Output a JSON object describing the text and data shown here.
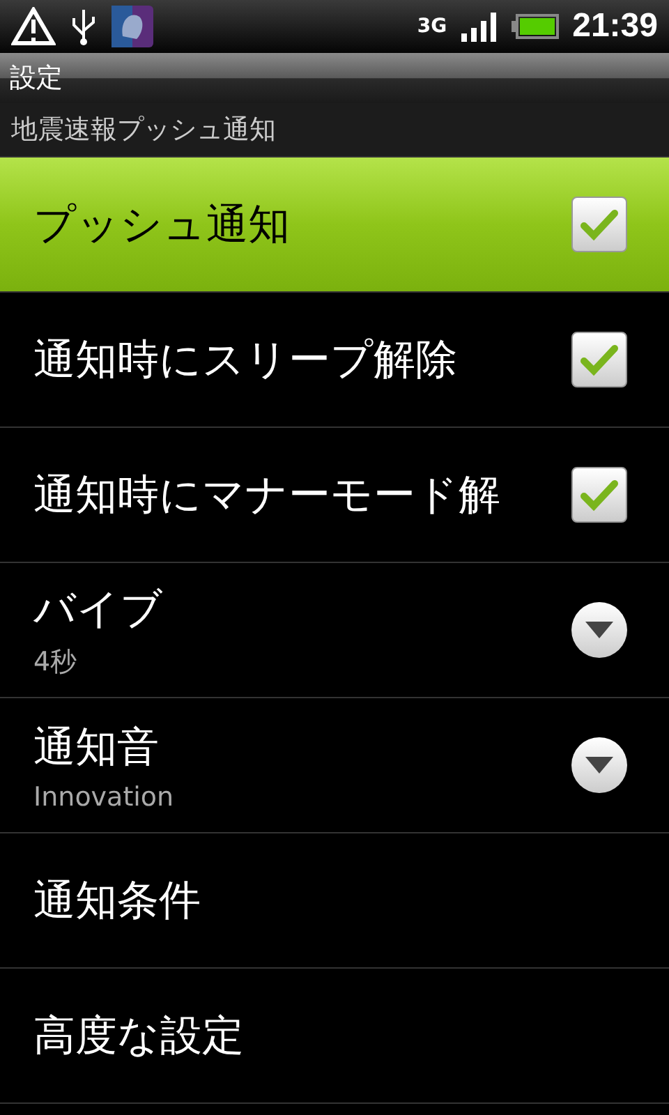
{
  "status_bar": {
    "network": "3G",
    "time": "21:39"
  },
  "title_bar": {
    "title": "設定"
  },
  "section_header": "地震速報プッシュ通知",
  "rows": [
    {
      "kind": "checkbox",
      "title": "プッシュ通知",
      "selected": true,
      "checked": true
    },
    {
      "kind": "checkbox",
      "title": "通知時にスリープ解除",
      "selected": false,
      "checked": true
    },
    {
      "kind": "checkbox",
      "title": "通知時にマナーモード解",
      "selected": false,
      "checked": true
    },
    {
      "kind": "dropdown",
      "title": "バイブ",
      "summary": "4秒",
      "selected": false
    },
    {
      "kind": "dropdown",
      "title": "通知音",
      "summary": "Innovation",
      "selected": false
    },
    {
      "kind": "plain",
      "title": "通知条件",
      "selected": false
    },
    {
      "kind": "plain",
      "title": "高度な設定",
      "selected": false
    }
  ]
}
